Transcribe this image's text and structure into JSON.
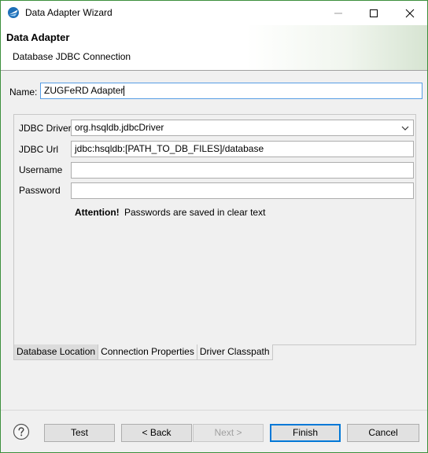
{
  "window": {
    "title": "Data Adapter Wizard"
  },
  "header": {
    "title": "Data Adapter",
    "subtitle": "Database JDBC Connection"
  },
  "name_field": {
    "label": "Name:",
    "value": "ZUGFeRD Adapter"
  },
  "form": {
    "jdbc_driver": {
      "label": "JDBC Driver",
      "value": "org.hsqldb.jdbcDriver"
    },
    "jdbc_url": {
      "label": "JDBC Url",
      "value": "jdbc:hsqldb:[PATH_TO_DB_FILES]/database"
    },
    "username": {
      "label": "Username",
      "value": ""
    },
    "password": {
      "label": "Password",
      "value": ""
    },
    "attention": {
      "strong": "Attention!",
      "text": "Passwords are saved in clear text"
    }
  },
  "tabs": [
    {
      "label": "Database Location",
      "active": true
    },
    {
      "label": "Connection Properties",
      "active": false
    },
    {
      "label": "Driver Classpath",
      "active": false
    }
  ],
  "buttons": {
    "test": "Test",
    "back": "< Back",
    "next": "Next >",
    "finish": "Finish",
    "cancel": "Cancel"
  },
  "icons": {
    "app": "eclipse-icon",
    "minimize": "minimize-icon",
    "maximize": "maximize-icon",
    "close": "close-icon",
    "help": "help-icon",
    "dropdown": "chevron-down-icon"
  },
  "colors": {
    "window_border": "#3c8f3c",
    "focus_border": "#569de5",
    "default_button_border": "#0078d7"
  }
}
